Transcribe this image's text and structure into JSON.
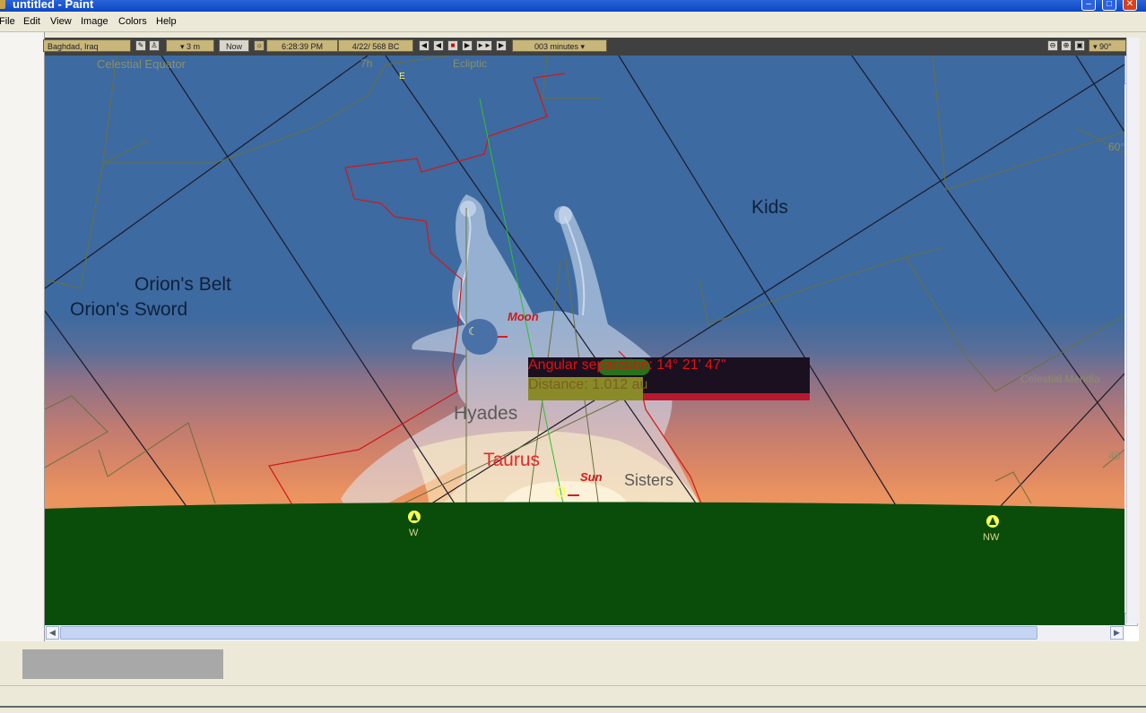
{
  "window": {
    "title": "untitled - Paint"
  },
  "menu": [
    "File",
    "Edit",
    "View",
    "Image",
    "Colors",
    "Help"
  ],
  "toolbar": {
    "location": "Baghdad, Iraq",
    "timestep": "▾ 3 m",
    "now_label": "Now",
    "time": "6:28:39 PM",
    "date": "4/22/ 568 BC",
    "flow": "003 minutes ▾",
    "fov": "▾ 90°"
  },
  "sky": {
    "labels": {
      "celestial_equator": "Celestial Equator",
      "ecliptic": "Ecliptic",
      "ecl_tick": "7h",
      "ecl_marker": "E",
      "kids": "Kids",
      "orions_belt": "Orion's Belt",
      "orions_sword": "Orion's Sword",
      "hyades": "Hyades",
      "taurus": "Taurus",
      "sisters": "Sisters",
      "celestial_meridian": "Celestial Meridia",
      "alt_60": "60°",
      "alt_45": "45"
    },
    "moon_label": "Moon",
    "sun_label": "Sun",
    "readout": {
      "angular_separation": "Angular separation: 14° 21' 47\"",
      "distance": "Distance: 1.012 au"
    },
    "compass": [
      {
        "label": "W"
      },
      {
        "label": "NW"
      }
    ]
  },
  "colors": {
    "ground": "#0a4d0a",
    "sky_top": "#3d6aa0",
    "horizon_glow": "#eb9460",
    "constellation_boundary": "#d01818",
    "readout_text": "#e01010",
    "titlebar": "#0b47c5"
  }
}
